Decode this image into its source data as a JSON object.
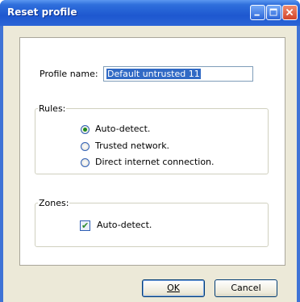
{
  "window": {
    "title": "Reset profile"
  },
  "profile": {
    "label": "Profile name:",
    "value": "Default untrusted 11"
  },
  "rules": {
    "legend": "Rules:",
    "options": [
      {
        "label": "Auto-detect.",
        "selected": true
      },
      {
        "label": "Trusted network.",
        "selected": false
      },
      {
        "label": "Direct internet connection.",
        "selected": false
      }
    ]
  },
  "zones": {
    "legend": "Zones:",
    "auto_detect_label": "Auto-detect.",
    "auto_detect_checked": true
  },
  "buttons": {
    "ok": "OK",
    "cancel": "Cancel"
  },
  "colors": {
    "titlebar": "#1e58d0",
    "close": "#d1452a",
    "dialog_bg": "#ece9d8",
    "selection": "#316ac5"
  }
}
